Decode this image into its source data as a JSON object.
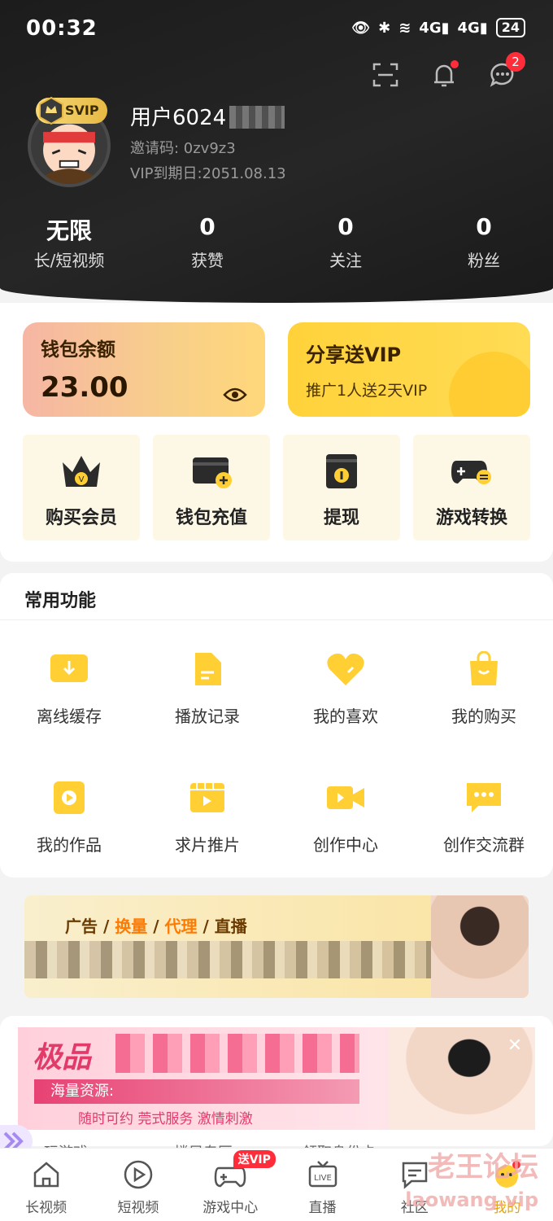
{
  "status_bar": {
    "time": "00:32",
    "network1": "4G",
    "network2": "4G",
    "battery": "24"
  },
  "header": {
    "notification_badge": "",
    "message_badge": "2",
    "svip_label": "SVIP",
    "username": "用户6024",
    "invite_code": "邀请码:  0zv9z3",
    "vip_expiry": "VIP到期日:2051.08.13"
  },
  "stats": [
    {
      "value": "无限",
      "label": "长/短视频"
    },
    {
      "value": "0",
      "label": "获赞"
    },
    {
      "value": "0",
      "label": "关注"
    },
    {
      "value": "0",
      "label": "粉丝"
    }
  ],
  "wallet": {
    "title": "钱包余额",
    "amount": "23.00"
  },
  "share": {
    "title": "分享送VIP",
    "subtitle": "推广1人送2天VIP"
  },
  "quick_actions": [
    {
      "label": "购买会员",
      "icon": "crown-icon"
    },
    {
      "label": "钱包充值",
      "icon": "wallet-add-icon"
    },
    {
      "label": "提现",
      "icon": "withdraw-icon"
    },
    {
      "label": "游戏转换",
      "icon": "gamepad-exchange-icon"
    }
  ],
  "common": {
    "title": "常用功能",
    "items": [
      {
        "label": "离线缓存",
        "icon": "download-icon"
      },
      {
        "label": "播放记录",
        "icon": "document-icon"
      },
      {
        "label": "我的喜欢",
        "icon": "heart-icon"
      },
      {
        "label": "我的购买",
        "icon": "shopping-bag-icon"
      },
      {
        "label": "我的作品",
        "icon": "play-icon"
      },
      {
        "label": "求片推片",
        "icon": "film-icon"
      },
      {
        "label": "创作中心",
        "icon": "video-camera-icon"
      },
      {
        "label": "创作交流群",
        "icon": "chat-icon"
      }
    ]
  },
  "ad_banner": {
    "tags": [
      "广告",
      "/",
      "换量",
      "/",
      "代理",
      "/",
      "直播"
    ]
  },
  "ad_popup": {
    "headline": "极品",
    "source": "海量资源:",
    "sub": "随时可约  莞式服务  激情刺激"
  },
  "under_labels": [
    "玩游戏",
    "楼凤专区",
    "领取身份卡"
  ],
  "tabbar": [
    {
      "label": "长视频",
      "icon": "home-icon"
    },
    {
      "label": "短视频",
      "icon": "play-circle-icon"
    },
    {
      "label": "游戏中心",
      "icon": "gamepad-icon",
      "badge": "送VIP"
    },
    {
      "label": "直播",
      "icon": "live-tv-icon"
    },
    {
      "label": "社区",
      "icon": "community-icon"
    },
    {
      "label": "我的",
      "icon": "profile-icon",
      "active": true
    }
  ],
  "watermark": {
    "line1": "老王论坛",
    "line2": "laowang.vip"
  },
  "colors": {
    "accent": "#ffd23a",
    "icon_yellow": "#ffcf33",
    "badge_red": "#ff2d3a",
    "header_bg": "#1c1c1c"
  }
}
